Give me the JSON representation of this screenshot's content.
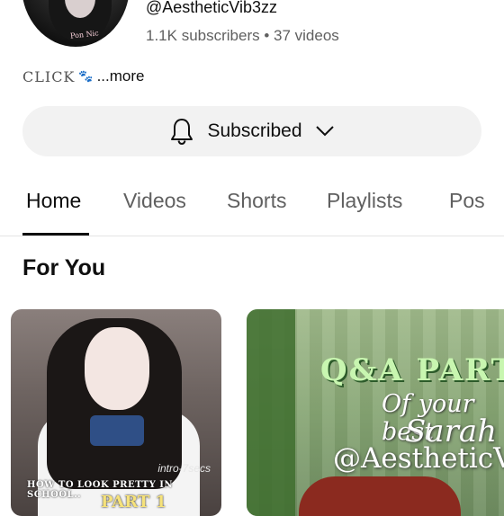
{
  "channel": {
    "handle": "@AestheticVib3zz",
    "stats": "1.1K subscribers • 37 videos",
    "avatar_text": "Pon Nic",
    "description": {
      "text": "CLICK",
      "emoji": "🐾",
      "more": "...more"
    }
  },
  "subscribe_button": {
    "label": "Subscribed",
    "icon_left": "bell-icon",
    "icon_right": "chevron-down-icon"
  },
  "tabs": [
    {
      "label": "Home",
      "active": true
    },
    {
      "label": "Videos",
      "active": false
    },
    {
      "label": "Shorts",
      "active": false
    },
    {
      "label": "Playlists",
      "active": false
    },
    {
      "label": "Pos",
      "active": false
    }
  ],
  "section": {
    "title": "For You"
  },
  "videos": [
    {
      "corner_text": "intro-7secs",
      "caption": "HOW TO LOOK PRETTY IN SCHOOL..",
      "caption2": "PART 1"
    },
    {
      "title_text": "Q&A PART",
      "subtitle_text": "Of your best",
      "name_text": "Sarah",
      "watermark_text": "@AestheticVi"
    }
  ],
  "colors": {
    "accent": "#0f0f0f",
    "button_bg": "#f2f2f2",
    "secondary_text": "#606060"
  }
}
